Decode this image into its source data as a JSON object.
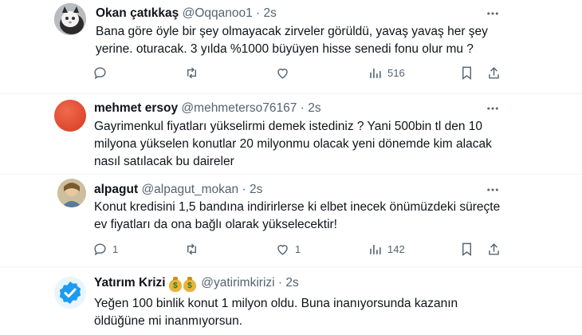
{
  "tweets": [
    {
      "name": "Okan çatıkkaş",
      "handle": "@Oqqanoo1",
      "time": "2s",
      "text_lines": [
        "Bana göre öyle bir şey olmayacak zirveler görüldü, yavaş yavaş her şey",
        "yerine.  oturacak. 3 yılda %1000 büyüyen hisse senedi fonu olur mu ?"
      ],
      "views": "516"
    },
    {
      "name": "mehmet ersoy",
      "handle": "@mehmeterso76167",
      "time": "2s",
      "text_lines": [
        "Gayrimenkul fiyatları yükselirmi demek istediniz ? Yani 500bin tl den 10",
        "milyona yükselen konutlar 20 milyonmu olacak yeni dönemde kim alacak",
        "nasıl satılacak bu daireler"
      ]
    },
    {
      "name": "alpagut",
      "handle": "@alpagut_mokan",
      "time": "2s",
      "text_lines": [
        "Konut kredisini 1,5 bandına indirirlerse ki elbet inecek önümüzdeki süreçte",
        "ev fiyatları da ona bağlı olarak yükselecektir!"
      ],
      "replies": "1",
      "likes": "1",
      "views": "142"
    },
    {
      "name": "Yatırım Krizi",
      "name_emojis": [
        "$",
        "$"
      ],
      "handle": "@yatirimkirizi",
      "time": "2s",
      "text_lines": [
        "Yeğen 100 binlik konut 1  milyon oldu. Buna inanıyorsunda kazanın",
        "öldüğüne mi inanmıyorsun."
      ]
    }
  ],
  "separator": "·",
  "colors": {
    "text": "#0f1419",
    "muted": "#536471",
    "divider": "#eff3f4",
    "verified": "#1d9bf0",
    "avatar2": "#e0452b"
  }
}
